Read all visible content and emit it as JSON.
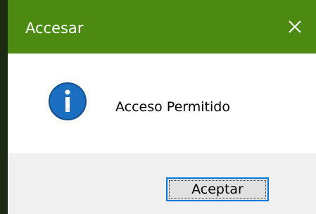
{
  "dialog": {
    "title": "Accesar",
    "message": "Acceso Permitido",
    "icon": "info-icon",
    "close_icon": "close-icon",
    "buttons": {
      "accept_label": "Aceptar"
    }
  },
  "colors": {
    "titlebar": "#4c8a12",
    "title_text": "#ffffff",
    "info_icon_fill": "#1c6fc0",
    "button_border": "#0078d7",
    "button_bg": "#e1e1e1",
    "footer_bg": "#f0f0f0",
    "content_bg": "#ffffff"
  }
}
